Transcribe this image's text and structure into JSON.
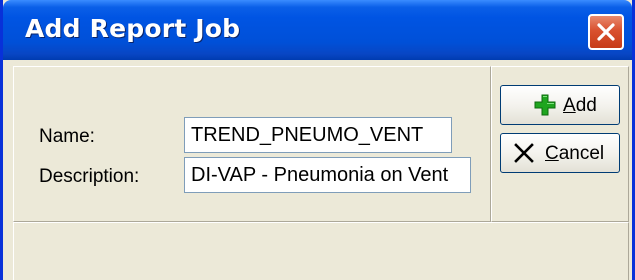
{
  "window": {
    "title": "Add Report Job"
  },
  "form": {
    "name_label": "Name:",
    "name_value": "TREND_PNEUMO_VENT",
    "description_label": "Description:",
    "description_value": "DI-VAP - Pneumonia on Vent"
  },
  "buttons": {
    "add_label": "Add",
    "cancel_label": "Cancel"
  },
  "icons": {
    "close": "close-icon",
    "add": "plus-icon",
    "cancel": "x-icon"
  },
  "colors": {
    "titlebar": "#0054e3",
    "close_button": "#d9512f",
    "add_icon": "#1fa51f",
    "face": "#ece9d8"
  }
}
